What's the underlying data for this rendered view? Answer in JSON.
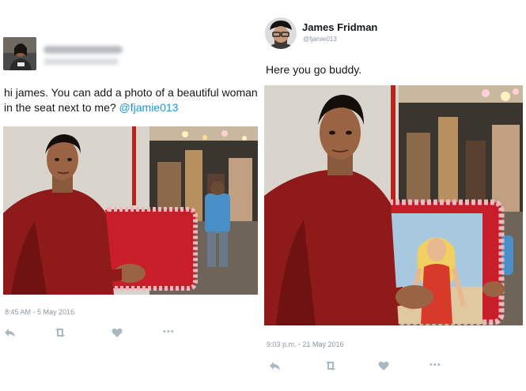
{
  "left_tweet": {
    "text_prefix": "hi james. You can add a photo of a beautiful woman in the seat next to me? ",
    "mention": "@fjamie013",
    "timestamp": "8:45 AM - 5 May 2016",
    "avatar_icon": "user-avatar-photo",
    "photo_description_icon": "man-sitting-on-red-chair-photo",
    "actions": [
      "reply-icon",
      "retweet-icon",
      "like-icon",
      "more-icon"
    ]
  },
  "right_tweet": {
    "name": "James Fridman",
    "handle": "@fjamie013",
    "text": "Here you go buddy.",
    "timestamp": "9:03 p.m. - 21 May 2016",
    "avatar_icon": "james-fridman-avatar-photo",
    "photo_description_icon": "man-holding-poster-photo",
    "actions": [
      "reply-icon",
      "retweet-icon",
      "like-icon",
      "more-icon"
    ]
  },
  "colors": {
    "link": "#1b95e0",
    "muted": "#8899a6",
    "icon": "#aab8c2",
    "text": "#14171a"
  }
}
